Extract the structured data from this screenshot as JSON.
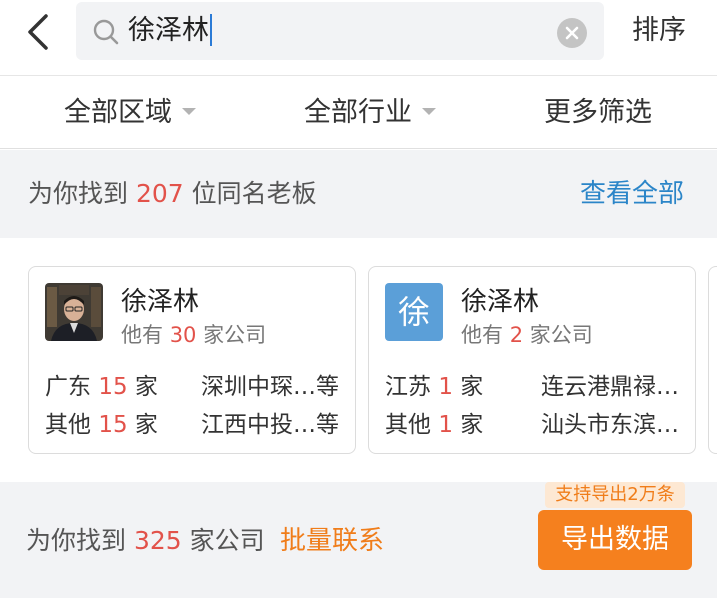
{
  "header": {
    "search_value": "徐泽林",
    "sort_label": "排序",
    "icons": {
      "back": "chevron-left-icon",
      "search": "search-icon",
      "clear": "clear-icon"
    }
  },
  "filters": [
    {
      "label": "全部区域",
      "has_dropdown": true
    },
    {
      "label": "全部行业",
      "has_dropdown": true
    },
    {
      "label": "更多筛选",
      "has_dropdown": false
    }
  ],
  "bosses_summary": {
    "prefix": "为你找到 ",
    "count": "207",
    "suffix": " 位同名老板",
    "view_all": "查看全部"
  },
  "cards": [
    {
      "name": "徐泽林",
      "avatar": "photo",
      "sub_prefix": "他有 ",
      "sub_count": "30",
      "sub_suffix": " 家公司",
      "rows": [
        {
          "region": "广东",
          "count": "15",
          "unit": "家",
          "company": "深圳中琛…等"
        },
        {
          "region": "其他",
          "count": "15",
          "unit": "家",
          "company": "江西中投…等"
        }
      ]
    },
    {
      "name": "徐泽林",
      "avatar": "letter",
      "avatar_letter": "徐",
      "sub_prefix": "他有 ",
      "sub_count": "2",
      "sub_suffix": " 家公司",
      "rows": [
        {
          "region": "江苏",
          "count": "1",
          "unit": "家",
          "company": "连云港鼎禄…"
        },
        {
          "region": "其他",
          "count": "1",
          "unit": "家",
          "company": "汕头市东滨…"
        }
      ]
    }
  ],
  "companies_summary": {
    "prefix": "为你找到 ",
    "count": "325",
    "suffix": " 家公司",
    "bulk_contact": "批量联系"
  },
  "export": {
    "tag": "支持导出2万条",
    "button": "导出数据"
  },
  "colors": {
    "accent_red": "#e2524a",
    "link_blue": "#2b85c8",
    "orange": "#f5801e",
    "avatar_blue": "#5b9fd8"
  }
}
